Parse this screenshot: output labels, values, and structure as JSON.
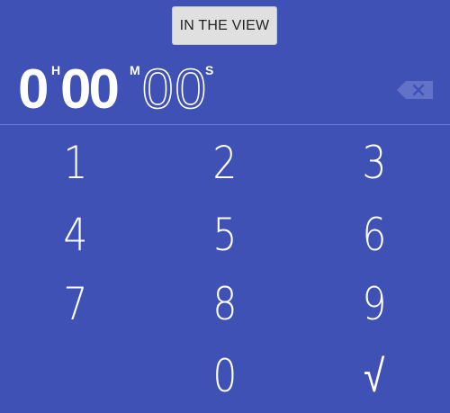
{
  "toolbar": {
    "in_the_view_label": "IN THE VIEW"
  },
  "timer_input": {
    "hours": "0",
    "hours_unit": "H",
    "minutes": "00",
    "minutes_unit": "M",
    "seconds": "00",
    "seconds_unit": "S"
  },
  "keypad": {
    "keys": [
      "1",
      "2",
      "3",
      "4",
      "5",
      "6",
      "7",
      "8",
      "9",
      "0",
      "√"
    ]
  },
  "icons": {
    "backspace": "backspace-icon"
  },
  "colors": {
    "background": "#3f51b5",
    "divider": "#6e7ccf",
    "backspace_icon": "#6272c9",
    "button_bg": "#e0e0e0"
  }
}
